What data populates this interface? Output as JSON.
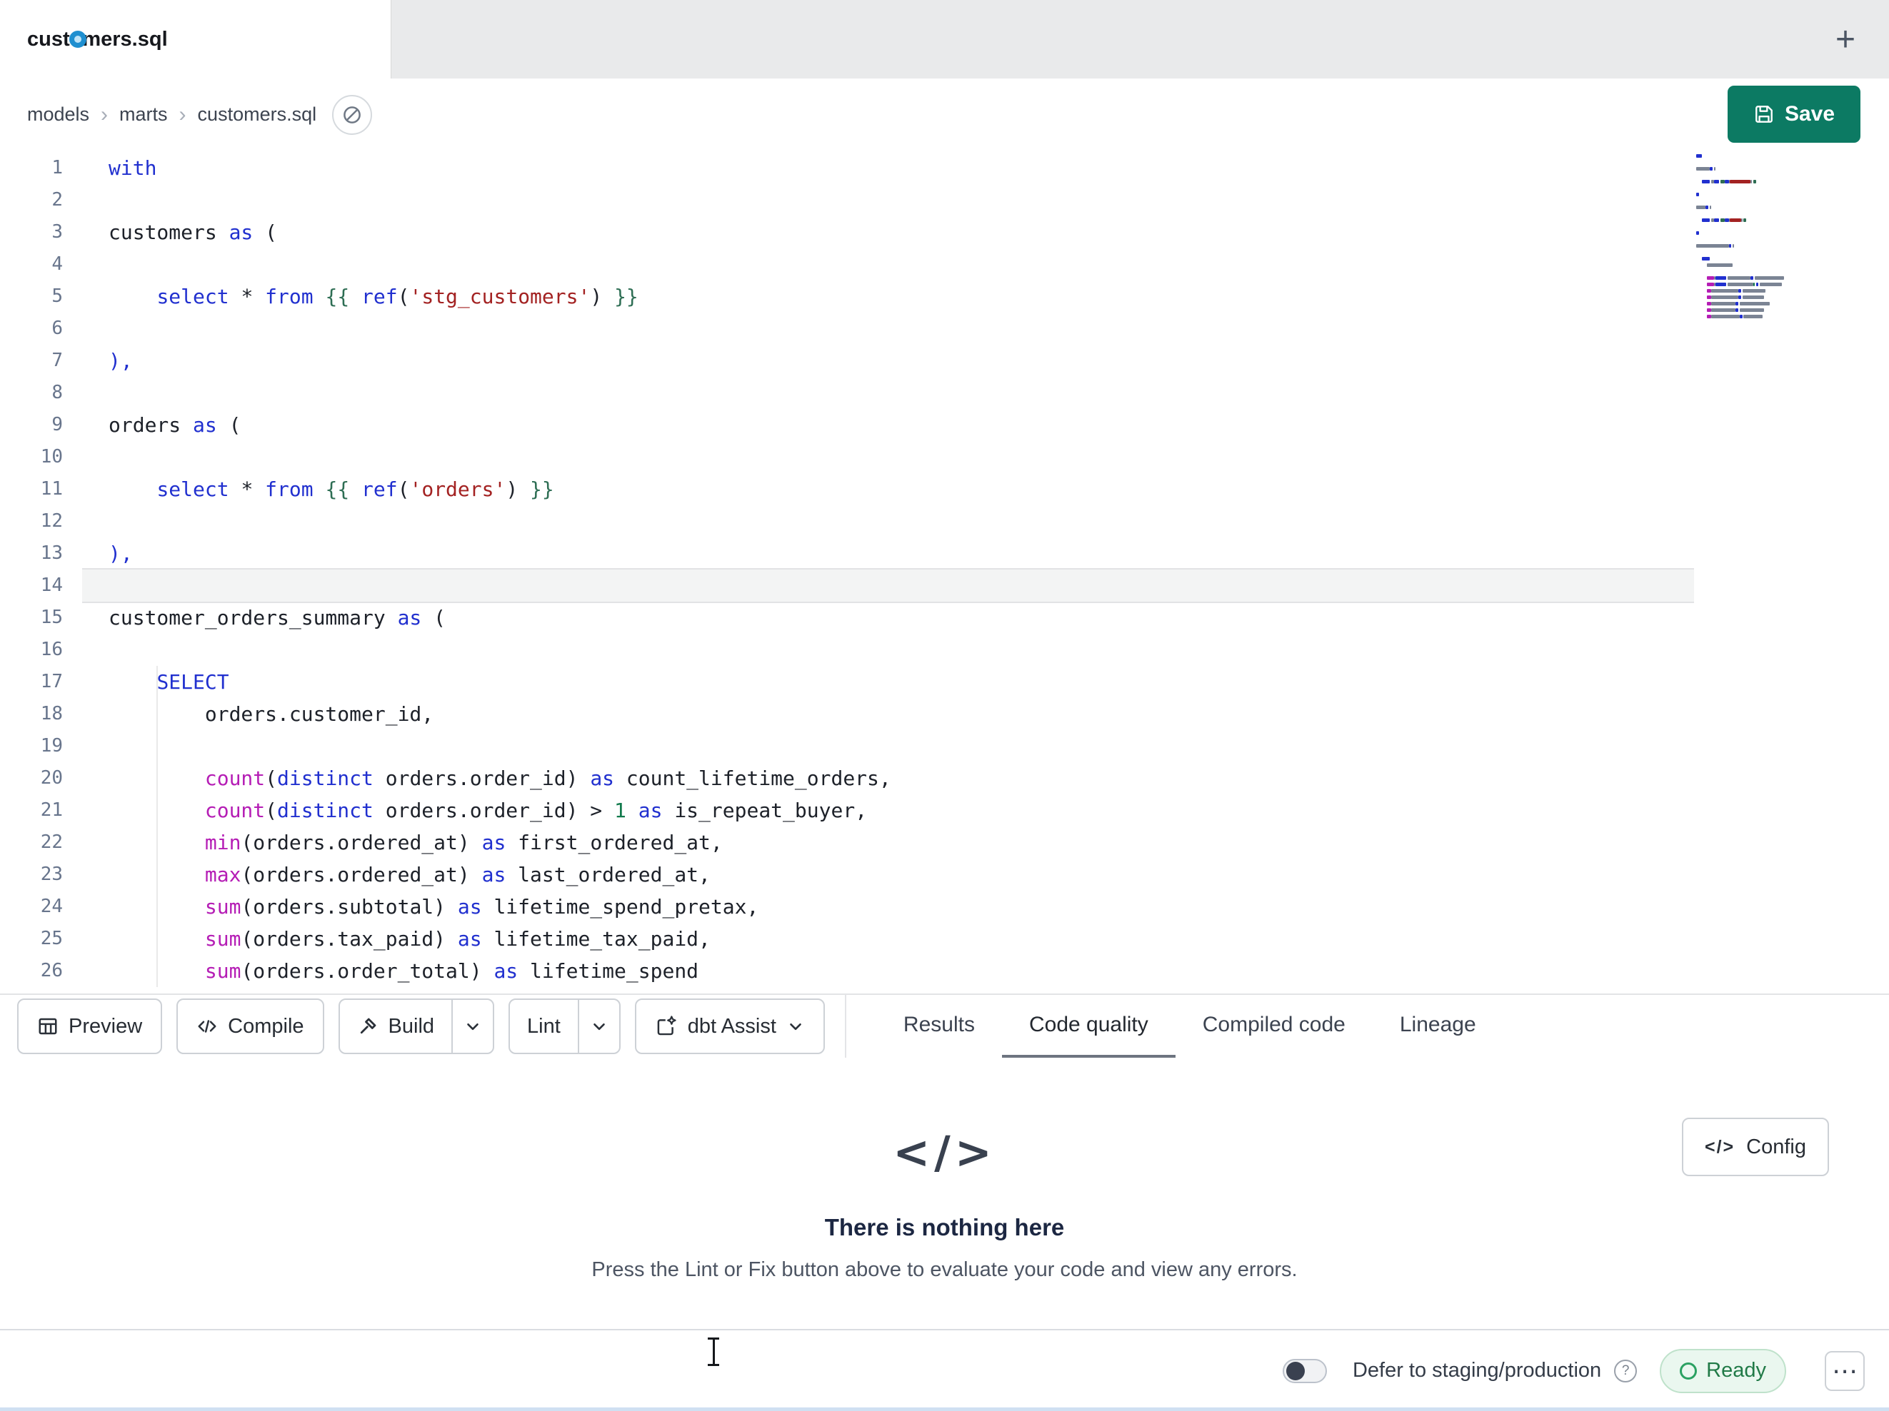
{
  "colors": {
    "kw": "#2130cf",
    "fn": "#b51db5",
    "str": "#a32222",
    "jinja": "#2e6e54",
    "num": "#117a4c",
    "plain": "#1d2129",
    "save": "#0c7a63",
    "dot": "#1f8fd0",
    "ready": "#217a47",
    "mmplain": "#7b8494"
  },
  "tab_bar": {
    "active_tab": "customers.sql",
    "unsaved_indicator": true,
    "new_tab_icon": "+"
  },
  "breadcrumb": {
    "items": [
      "models",
      "marts",
      "customers.sql"
    ],
    "separator": "›"
  },
  "save_button": {
    "label": "Save"
  },
  "editor": {
    "active_line": 14,
    "lines": [
      {
        "n": 1,
        "tokens": [
          [
            "k",
            "with"
          ]
        ]
      },
      {
        "n": 2,
        "tokens": []
      },
      {
        "n": 3,
        "tokens": [
          [
            "t",
            "customers "
          ],
          [
            "k",
            "as"
          ],
          [
            "t",
            " ("
          ]
        ]
      },
      {
        "n": 4,
        "tokens": []
      },
      {
        "n": 5,
        "tokens": [
          [
            "t",
            "    "
          ],
          [
            "k",
            "select"
          ],
          [
            "t",
            " * "
          ],
          [
            "k",
            "from"
          ],
          [
            "t",
            " "
          ],
          [
            "j",
            "{{ "
          ],
          [
            "k",
            "ref"
          ],
          [
            "t",
            "("
          ],
          [
            "s",
            "'stg_customers'"
          ],
          [
            "t",
            ")"
          ],
          [
            "j",
            " }}"
          ]
        ]
      },
      {
        "n": 6,
        "tokens": []
      },
      {
        "n": 7,
        "tokens": [
          [
            "k",
            "),"
          ]
        ]
      },
      {
        "n": 8,
        "tokens": []
      },
      {
        "n": 9,
        "tokens": [
          [
            "t",
            "orders "
          ],
          [
            "k",
            "as"
          ],
          [
            "t",
            " ("
          ]
        ]
      },
      {
        "n": 10,
        "tokens": []
      },
      {
        "n": 11,
        "tokens": [
          [
            "t",
            "    "
          ],
          [
            "k",
            "select"
          ],
          [
            "t",
            " * "
          ],
          [
            "k",
            "from"
          ],
          [
            "t",
            " "
          ],
          [
            "j",
            "{{ "
          ],
          [
            "k",
            "ref"
          ],
          [
            "t",
            "("
          ],
          [
            "s",
            "'orders'"
          ],
          [
            "t",
            ")"
          ],
          [
            "j",
            " }}"
          ]
        ]
      },
      {
        "n": 12,
        "tokens": []
      },
      {
        "n": 13,
        "tokens": [
          [
            "k",
            "),"
          ]
        ]
      },
      {
        "n": 14,
        "tokens": []
      },
      {
        "n": 15,
        "tokens": [
          [
            "t",
            "customer_orders_summary "
          ],
          [
            "k",
            "as"
          ],
          [
            "t",
            " ("
          ]
        ]
      },
      {
        "n": 16,
        "tokens": []
      },
      {
        "n": 17,
        "tokens": [
          [
            "t",
            "    "
          ],
          [
            "k",
            "SELECT"
          ]
        ]
      },
      {
        "n": 18,
        "tokens": [
          [
            "t",
            "        orders.customer_id,"
          ]
        ]
      },
      {
        "n": 19,
        "tokens": []
      },
      {
        "n": 20,
        "tokens": [
          [
            "t",
            "        "
          ],
          [
            "f",
            "count"
          ],
          [
            "t",
            "("
          ],
          [
            "k",
            "distinct"
          ],
          [
            "t",
            " orders.order_id) "
          ],
          [
            "k",
            "as"
          ],
          [
            "t",
            " count_lifetime_orders,"
          ]
        ]
      },
      {
        "n": 21,
        "tokens": [
          [
            "t",
            "        "
          ],
          [
            "f",
            "count"
          ],
          [
            "t",
            "("
          ],
          [
            "k",
            "distinct"
          ],
          [
            "t",
            " orders.order_id) > "
          ],
          [
            "n",
            "1"
          ],
          [
            "t",
            " "
          ],
          [
            "k",
            "as"
          ],
          [
            "t",
            " is_repeat_buyer,"
          ]
        ]
      },
      {
        "n": 22,
        "tokens": [
          [
            "t",
            "        "
          ],
          [
            "f",
            "min"
          ],
          [
            "t",
            "(orders.ordered_at) "
          ],
          [
            "k",
            "as"
          ],
          [
            "t",
            " first_ordered_at,"
          ]
        ]
      },
      {
        "n": 23,
        "tokens": [
          [
            "t",
            "        "
          ],
          [
            "f",
            "max"
          ],
          [
            "t",
            "(orders.ordered_at) "
          ],
          [
            "k",
            "as"
          ],
          [
            "t",
            " last_ordered_at,"
          ]
        ]
      },
      {
        "n": 24,
        "tokens": [
          [
            "t",
            "        "
          ],
          [
            "f",
            "sum"
          ],
          [
            "t",
            "(orders.subtotal) "
          ],
          [
            "k",
            "as"
          ],
          [
            "t",
            " lifetime_spend_pretax,"
          ]
        ]
      },
      {
        "n": 25,
        "tokens": [
          [
            "t",
            "        "
          ],
          [
            "f",
            "sum"
          ],
          [
            "t",
            "(orders.tax_paid) "
          ],
          [
            "k",
            "as"
          ],
          [
            "t",
            " lifetime_tax_paid,"
          ]
        ]
      },
      {
        "n": 26,
        "tokens": [
          [
            "t",
            "        "
          ],
          [
            "f",
            "sum"
          ],
          [
            "t",
            "(orders.order_total) "
          ],
          [
            "k",
            "as"
          ],
          [
            "t",
            " lifetime_spend"
          ]
        ]
      }
    ]
  },
  "toolbar": {
    "preview": "Preview",
    "compile": "Compile",
    "build": "Build",
    "lint": "Lint",
    "assist": "dbt Assist"
  },
  "panel_tabs": [
    {
      "label": "Results",
      "active": false
    },
    {
      "label": "Code quality",
      "active": true
    },
    {
      "label": "Compiled code",
      "active": false
    },
    {
      "label": "Lineage",
      "active": false
    }
  ],
  "empty_state": {
    "icon": "</>",
    "title": "There is nothing here",
    "message": "Press the Lint or Fix button above to evaluate your code and view any errors."
  },
  "config_button": {
    "icon": "</>",
    "label": "Config"
  },
  "status_bar": {
    "toggle_on": false,
    "defer_label": "Defer to staging/production",
    "help_icon": "?",
    "ready_label": "Ready",
    "more_icon": "⋯"
  }
}
